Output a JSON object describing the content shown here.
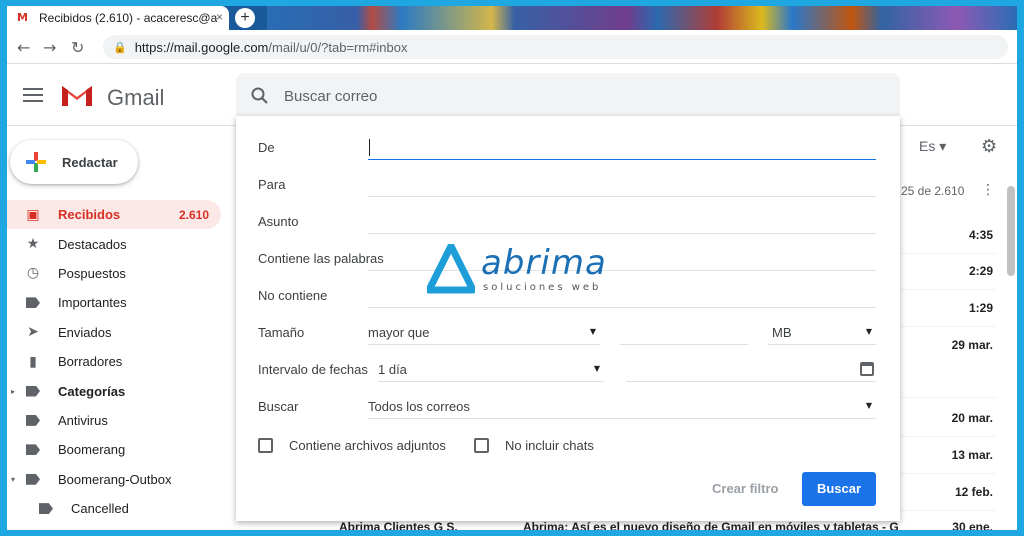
{
  "browser": {
    "tab_title": "Recibidos (2.610) - acaceresc@a",
    "tab_favicon_text": "M",
    "tab_close": "×",
    "new_tab": "+",
    "url_host": "https://mail.google.com",
    "url_path": "/mail/u/0/?tab=rm#inbox"
  },
  "gmail": {
    "product_name": "Gmail",
    "search_placeholder": "Buscar correo"
  },
  "sidebar": {
    "compose_label": "Redactar",
    "items": [
      {
        "label": "Recibidos",
        "count": "2.610",
        "icon": "inbox-icon",
        "active": true
      },
      {
        "label": "Destacados",
        "icon": "star-icon"
      },
      {
        "label": "Pospuestos",
        "icon": "clock-icon"
      },
      {
        "label": "Importantes",
        "icon": "important-icon"
      },
      {
        "label": "Enviados",
        "icon": "send-icon"
      },
      {
        "label": "Borradores",
        "icon": "draft-icon"
      },
      {
        "label": "Categorías",
        "icon": "label-icon",
        "bold": true,
        "caret": "▸"
      },
      {
        "label": "Antivirus",
        "icon": "label-icon"
      },
      {
        "label": "Boomerang",
        "icon": "label-icon"
      },
      {
        "label": "Boomerang-Outbox",
        "icon": "label-icon",
        "caret": "▾"
      },
      {
        "label": "Cancelled",
        "icon": "label-icon",
        "sub": true
      }
    ]
  },
  "toolbar": {
    "language": "Es ▾",
    "pager": "25 de 2.610"
  },
  "mail_rows": [
    {
      "date": "4:35"
    },
    {
      "date": "2:29"
    },
    {
      "date": "1:29"
    },
    {
      "date": "29 mar."
    },
    {
      "date": "20 mar."
    },
    {
      "date": "13 mar."
    },
    {
      "date": "12 feb."
    }
  ],
  "last_row": {
    "sender": "Abrima Clientes G S.",
    "subject": "Abrima: Así es el nuevo diseño de Gmail en móviles y tabletas - G",
    "date": "30 ene."
  },
  "advanced_search": {
    "from_label": "De",
    "to_label": "Para",
    "subject_label": "Asunto",
    "has_words_label": "Contiene las palabras",
    "not_has_label": "No contiene",
    "size_label": "Tamaño",
    "size_operator": "mayor que",
    "size_unit": "MB",
    "date_range_label": "Intervalo de fechas",
    "date_range_value": "1 día",
    "search_in_label": "Buscar",
    "search_in_value": "Todos los correos",
    "has_attachment_label": "Contiene archivos adjuntos",
    "exclude_chats_label": "No incluir chats",
    "create_filter_label": "Crear filtro",
    "search_button_label": "Buscar"
  },
  "watermark": {
    "brand": "abrima",
    "tagline": "soluciones web"
  },
  "colors": {
    "accent": "#1a73e8",
    "inbox_red": "#d93025",
    "active_bg": "#fce8e6",
    "border_frame": "#1ea7e0"
  }
}
